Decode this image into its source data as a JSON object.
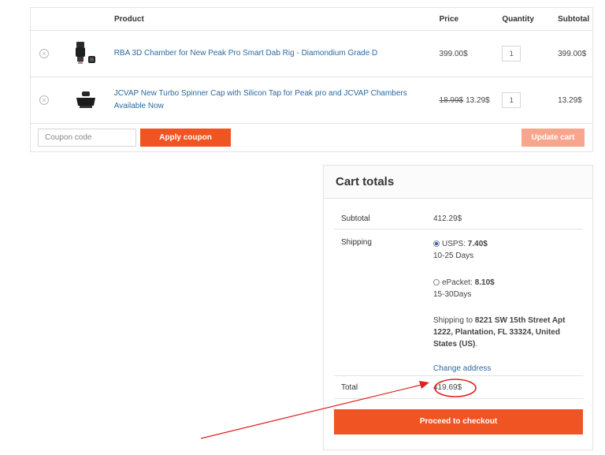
{
  "cart": {
    "headers": {
      "product": "Product",
      "price": "Price",
      "quantity": "Quantity",
      "subtotal": "Subtotal"
    },
    "items": [
      {
        "name": "RBA 3D Chamber for New Peak Pro Smart Dab Rig - Diamondium Grade D",
        "price": "399.00$",
        "old_price": "",
        "quantity": "1",
        "subtotal": "399.00$"
      },
      {
        "name": "JCVAP New Turbo Spinner Cap with Silicon Tap for Peak pro and JCVAP Chambers Available Now",
        "price": "13.29$",
        "old_price": "18.99$",
        "quantity": "1",
        "subtotal": "13.29$"
      }
    ],
    "coupon_placeholder": "Coupon code",
    "apply_label": "Apply coupon",
    "update_label": "Update cart"
  },
  "totals": {
    "title": "Cart totals",
    "subtotal_label": "Subtotal",
    "subtotal_value": "412.29$",
    "shipping_label": "Shipping",
    "usps_label": "USPS: ",
    "usps_price": "7.40$",
    "usps_days": "10-25 Days",
    "epacket_label": "ePacket: ",
    "epacket_price": "8.10$",
    "epacket_days": "15-30Days",
    "shipping_to_label": "Shipping to ",
    "shipping_address": "8221 SW 15th Street Apt 1222, Plantation, FL 33324, United States (US)",
    "address_period": ".",
    "change_address": "Change address",
    "total_label": "Total",
    "total_value": "419.69$",
    "checkout_label": "Proceed to checkout"
  },
  "colors": {
    "accent": "#f05423",
    "accent_disabled": "#f7a58c",
    "link": "#2c6aa0",
    "annotation": "#e0201f"
  }
}
